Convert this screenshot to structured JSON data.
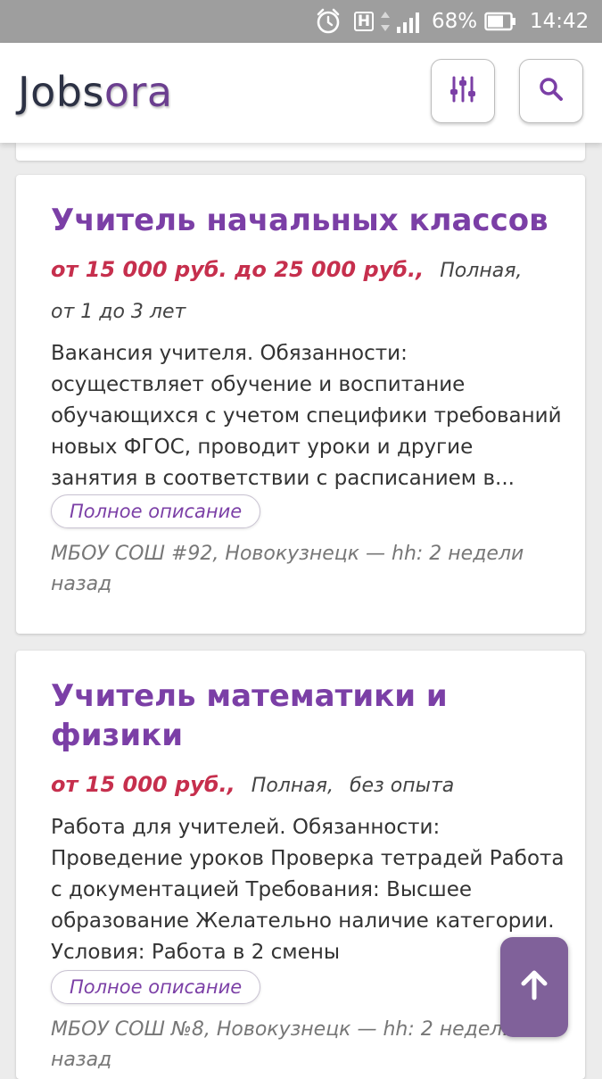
{
  "status_bar": {
    "battery_percent": "68%",
    "time": "14:42",
    "network_letter": "H"
  },
  "header": {
    "logo_part1": "Jobs",
    "logo_part2": "ora",
    "filter_icon": "sliders-icon",
    "search_icon": "search-icon"
  },
  "colors": {
    "accent": "#7b3fa6",
    "salary": "#c62f4d",
    "logo_dark": "#2c3144",
    "logo_purple": "#6b3f8f",
    "fab": "#80619a"
  },
  "jobs": [
    {
      "title": "Учитель начальных классов",
      "salary": "от 15 000 руб. до 25 000 руб.,",
      "employment": "Полная,",
      "experience": "от 1 до 3 лет",
      "description": "Вакансия учителя. Обязанности: осуществляет обучение и воспитание обучающихся с учетом специфики требований новых ФГОС, проводит уроки и другие занятия в соответствии с расписанием в...",
      "more_label": "Полное описание",
      "source": "МБОУ СОШ #92, Новокузнецк — hh: 2 недели назад"
    },
    {
      "title": "Учитель математики и физики",
      "salary": "от 15 000 руб.,",
      "employment": "Полная,",
      "experience": "без опыта",
      "description": "Работа для учителей. Обязанности: Проведение уроков Проверка тетрадей Работа с документацией Требования: Высшее образование Желательно наличие категории. Условия: Работа в 2 смены",
      "more_label": "Полное описание",
      "source": "МБОУ СОШ №8, Новокузнецк — hh: 2 недели назад"
    }
  ],
  "scroll_top_icon": "arrow-up-icon"
}
